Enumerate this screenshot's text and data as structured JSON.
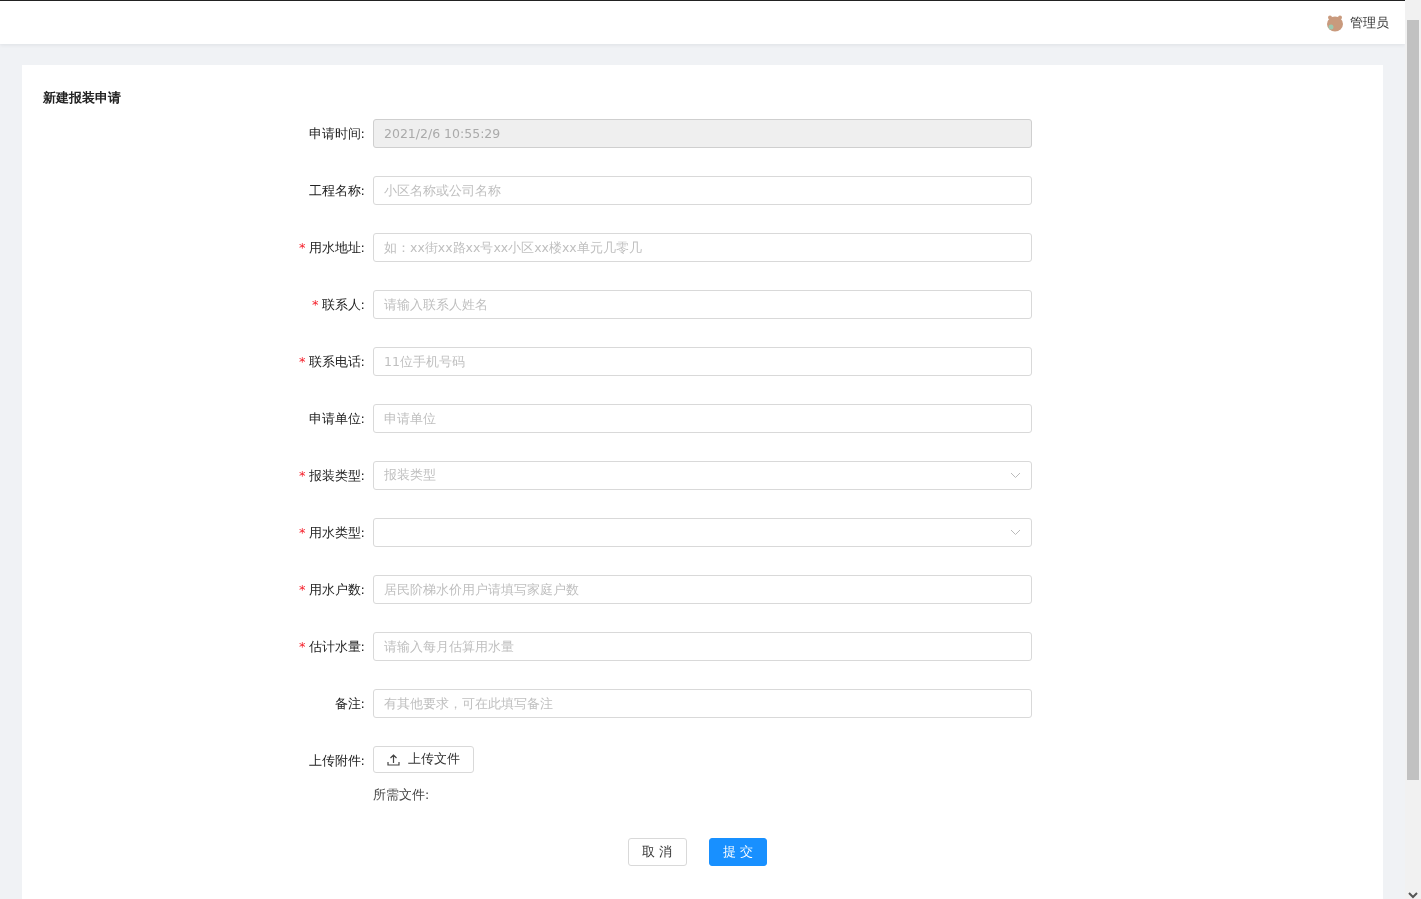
{
  "header": {
    "user": "管理员"
  },
  "form": {
    "title": "新建报装申请",
    "fields": [
      {
        "kind": "input",
        "label": "申请时间:",
        "disabled": true,
        "value": "2021/2/6 10:55:29"
      },
      {
        "kind": "input",
        "label": "工程名称:",
        "disabled": false,
        "placeholder": "小区名称或公司名称"
      },
      {
        "kind": "input",
        "required_mark": "*",
        "label": "用水地址:",
        "disabled": false,
        "placeholder": "如：xx街xx路xx号xx小区xx楼xx单元几零几"
      },
      {
        "kind": "input",
        "required_mark": "*",
        "label": "联系人:",
        "disabled": false,
        "placeholder": "请输入联系人姓名"
      },
      {
        "kind": "input",
        "required_mark": "*",
        "label": "联系电话:",
        "disabled": false,
        "placeholder": "11位手机号码"
      },
      {
        "kind": "input",
        "label": "申请单位:",
        "disabled": false,
        "placeholder": "申请单位"
      },
      {
        "kind": "select",
        "required_mark": "*",
        "label": "报装类型:",
        "placeholder": "报装类型"
      },
      {
        "kind": "select",
        "required_mark": "*",
        "label": "用水类型:"
      },
      {
        "kind": "input",
        "required_mark": "*",
        "label": "用水户数:",
        "disabled": false,
        "placeholder": "居民阶梯水价用户请填写家庭户数"
      },
      {
        "kind": "input",
        "required_mark": "*",
        "label": "估计水量:",
        "disabled": false,
        "placeholder": "请输入每月估算用水量"
      },
      {
        "kind": "input",
        "label": "备注:",
        "disabled": false,
        "placeholder": "有其他要求，可在此填写备注"
      },
      {
        "kind": "upload",
        "label": "上传附件:",
        "button": "上传文件",
        "note": "所需文件:"
      }
    ],
    "buttons": [
      {
        "kind": "default",
        "label": "取 消"
      },
      {
        "kind": "primary",
        "label": "提 交"
      }
    ]
  }
}
